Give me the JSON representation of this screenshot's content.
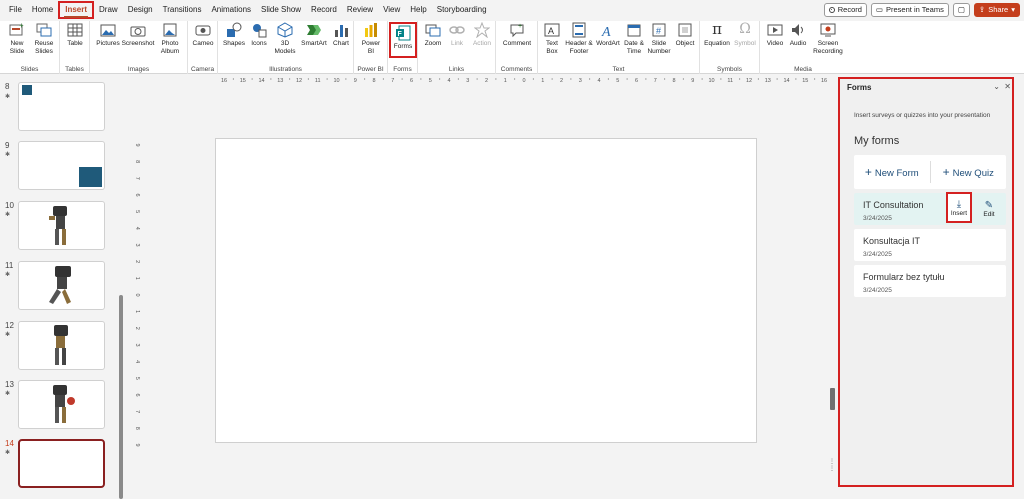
{
  "tabs": [
    "File",
    "Home",
    "Insert",
    "Draw",
    "Design",
    "Transitions",
    "Animations",
    "Slide Show",
    "Record",
    "Review",
    "View",
    "Help",
    "Storyboarding"
  ],
  "active_tab": "Insert",
  "top_right": {
    "record": "Record",
    "present": "Present in Teams",
    "share": "Share"
  },
  "ribbon": {
    "new_slide": "New Slide",
    "reuse_slides": "Reuse Slides",
    "slides_group": "Slides",
    "table": "Table",
    "tables_group": "Tables",
    "pictures": "Pictures",
    "screenshot": "Screenshot",
    "photo_album": "Photo Album",
    "images_group": "Images",
    "cameo": "Cameo",
    "camera_group": "Camera",
    "shapes": "Shapes",
    "icons": "Icons",
    "models_3d": "3D Models",
    "smartart": "SmartArt",
    "chart": "Chart",
    "illustrations_group": "Illustrations",
    "power_bi": "Power BI",
    "power_bi_group": "Power BI",
    "forms": "Forms",
    "forms_group": "Forms",
    "zoom": "Zoom",
    "link": "Link",
    "action": "Action",
    "links_group": "Links",
    "comment": "Comment",
    "comments_group": "Comments",
    "text_box": "Text Box",
    "header_footer": "Header & Footer",
    "wordart": "WordArt",
    "date_time": "Date & Time",
    "slide_number": "Slide Number",
    "object": "Object",
    "text_group": "Text",
    "equation": "Equation",
    "symbol": "Symbol",
    "symbols_group": "Symbols",
    "video": "Video",
    "audio": "Audio",
    "screen_recording": "Screen Recording",
    "media_group": "Media"
  },
  "slides": [
    {
      "num": "8"
    },
    {
      "num": "9"
    },
    {
      "num": "10"
    },
    {
      "num": "11"
    },
    {
      "num": "12"
    },
    {
      "num": "13"
    },
    {
      "num": "14"
    }
  ],
  "ruler_labels": [
    "16",
    "15",
    "14",
    "13",
    "12",
    "11",
    "10",
    "9",
    "8",
    "7",
    "6",
    "5",
    "4",
    "3",
    "2",
    "1",
    "0",
    "1",
    "2",
    "3",
    "4",
    "5",
    "6",
    "7",
    "8",
    "9",
    "10",
    "11",
    "12",
    "13",
    "14",
    "15",
    "16"
  ],
  "forms_pane": {
    "title": "Forms",
    "subtitle": "Insert surveys or quizzes into your presentation",
    "my_forms": "My forms",
    "new_form": "New Form",
    "new_quiz": "New Quiz",
    "forms": [
      {
        "name": "IT Consultation",
        "date": "3/24/2025"
      },
      {
        "name": "Konsultacja IT",
        "date": "3/24/2025"
      },
      {
        "name": "Formularz bez tytułu",
        "date": "3/24/2025"
      }
    ],
    "insert_label": "Insert",
    "edit_label": "Edit"
  },
  "colors": {
    "accent": "#c43e1c",
    "highlight": "#d42020",
    "forms_blue": "#1f4e79",
    "thumb_blue": "#1f5a7a"
  }
}
